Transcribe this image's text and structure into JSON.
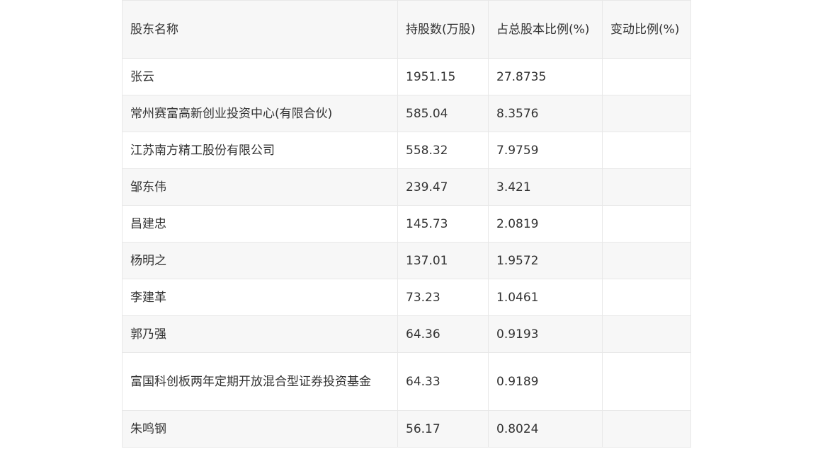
{
  "table": {
    "headers": [
      "股东名称",
      "持股数(万股)",
      "占总股本比例(%)",
      "变动比例(%)"
    ],
    "rows": [
      {
        "name": "张云",
        "shares": "1951.15",
        "ratio": "27.8735",
        "change": ""
      },
      {
        "name": "常州赛富高新创业投资中心(有限合伙)",
        "shares": "585.04",
        "ratio": "8.3576",
        "change": ""
      },
      {
        "name": "江苏南方精工股份有限公司",
        "shares": "558.32",
        "ratio": "7.9759",
        "change": ""
      },
      {
        "name": "邹东伟",
        "shares": "239.47",
        "ratio": "3.421",
        "change": ""
      },
      {
        "name": "昌建忠",
        "shares": "145.73",
        "ratio": "2.0819",
        "change": ""
      },
      {
        "name": "杨明之",
        "shares": "137.01",
        "ratio": "1.9572",
        "change": ""
      },
      {
        "name": "李建革",
        "shares": "73.23",
        "ratio": "1.0461",
        "change": ""
      },
      {
        "name": "郭乃强",
        "shares": "64.36",
        "ratio": "0.9193",
        "change": ""
      },
      {
        "name": "富国科创板两年定期开放混合型证券投资基金",
        "shares": "64.33",
        "ratio": "0.9189",
        "change": ""
      },
      {
        "name": "朱鸣钢",
        "shares": "56.17",
        "ratio": "0.8024",
        "change": ""
      }
    ]
  }
}
